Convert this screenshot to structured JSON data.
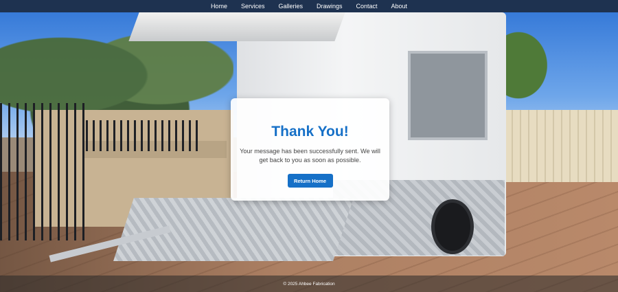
{
  "nav": {
    "items": [
      {
        "label": "Home"
      },
      {
        "label": "Services"
      },
      {
        "label": "Galleries"
      },
      {
        "label": "Drawings"
      },
      {
        "label": "Contact"
      },
      {
        "label": "About"
      }
    ]
  },
  "message": {
    "title": "Thank You!",
    "body": "Your message has been successfully sent. We will get back to you as soon as possible.",
    "button_label": "Return Home"
  },
  "footer": {
    "text": "© 2025 Ahbee Fabrication"
  },
  "colors": {
    "nav_background": "#1e3250",
    "accent": "#1670c7",
    "card_background": "#ffffff"
  }
}
